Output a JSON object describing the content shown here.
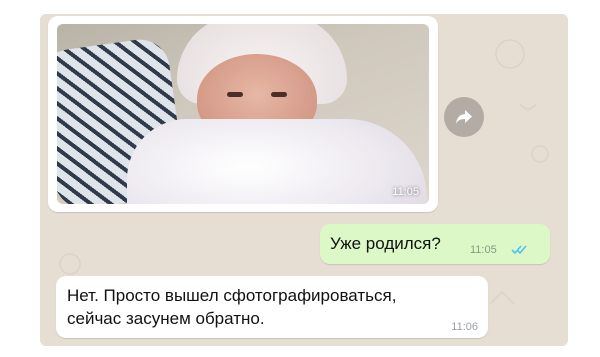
{
  "colors": {
    "chat_background": "#e6ddd3",
    "outgoing_bubble": "#dcf8c6",
    "incoming_bubble": "#ffffff",
    "read_ticks": "#4fc3f7"
  },
  "messages": {
    "photo": {
      "time": "11:05",
      "image_icon": "photo-of-newborn"
    },
    "forward": {
      "icon": "forward-arrow-icon"
    },
    "outgoing": {
      "text": "Уже родился?",
      "time": "11:05",
      "status_icon": "double-check-icon"
    },
    "incoming": {
      "text": "Нет. Просто вышел сфотографироваться, сейчас засунем обратно.",
      "time": "11:06"
    }
  }
}
